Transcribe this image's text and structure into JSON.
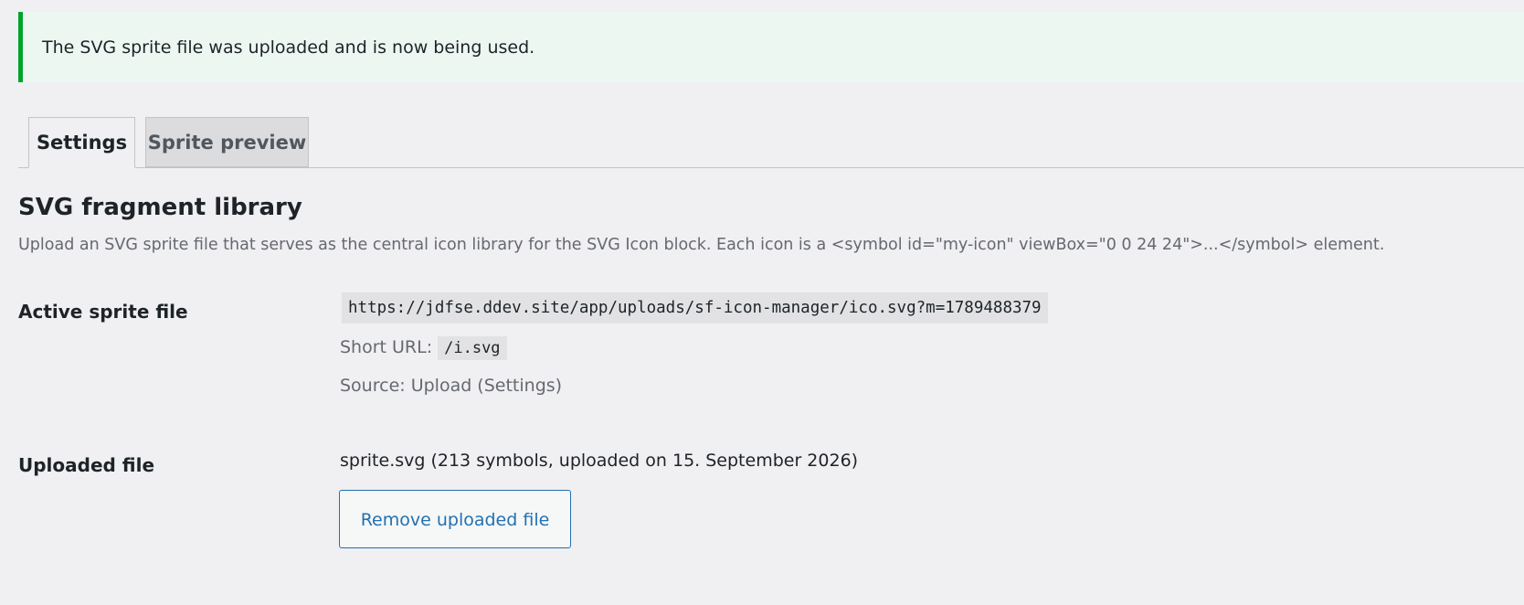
{
  "notice": {
    "message": "The SVG sprite file was uploaded and is now being used."
  },
  "tabs": [
    {
      "label": "Settings",
      "active": true
    },
    {
      "label": "Sprite preview",
      "active": false
    }
  ],
  "section": {
    "title": "SVG fragment library",
    "description": "Upload an SVG sprite file that serves as the central icon library for the SVG Icon block. Each icon is a <symbol id=\"my-icon\" viewBox=\"0 0 24 24\">...</symbol> element."
  },
  "active_sprite": {
    "label": "Active sprite file",
    "url": "https://jdfse.ddev.site/app/uploads/sf-icon-manager/ico.svg?m=1789488379",
    "short_url_label": "Short URL:",
    "short_url": "/i.svg",
    "source": "Source: Upload (Settings)"
  },
  "uploaded_file": {
    "label": "Uploaded file",
    "info": "sprite.svg (213 symbols, uploaded on 15. September 2026)",
    "remove_label": "Remove uploaded file"
  },
  "colors": {
    "success_border": "#00a32a",
    "notice_bg": "#edf7f2",
    "link_blue": "#2271b1",
    "page_bg": "#f0eff2"
  }
}
